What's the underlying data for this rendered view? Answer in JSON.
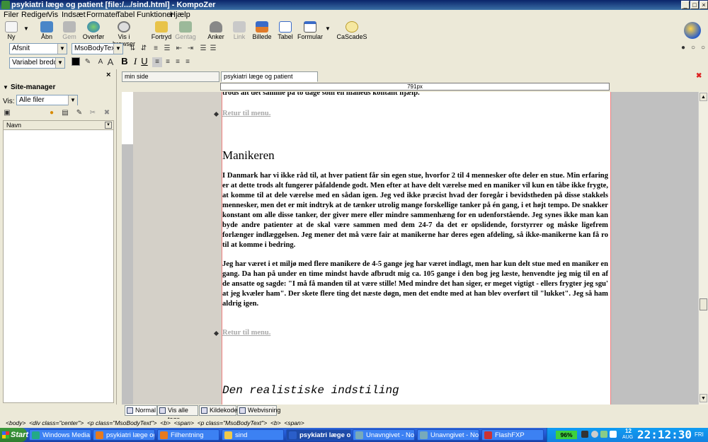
{
  "window": {
    "title": "psykiatri læge og patient [file:/.../sind.html] - KompoZer"
  },
  "menu": [
    "Filer",
    "Rediger",
    "Vis",
    "Indsæt",
    "Formater",
    "Tabel",
    "Funktioner",
    "Hjælp"
  ],
  "toolbar": {
    "buttons": [
      {
        "label": "Ny",
        "icon": "new-doc-icon"
      },
      {
        "label": "Åbn",
        "icon": "open-folder-icon"
      },
      {
        "label": "Gem",
        "icon": "save-disk-icon"
      },
      {
        "label": "Overfør",
        "icon": "publish-globe-icon"
      },
      {
        "label": "Vis i browser",
        "icon": "browser-preview-icon"
      },
      {
        "label": "Fortryd",
        "icon": "undo-arrow-icon"
      },
      {
        "label": "Gentag",
        "icon": "redo-arrow-icon"
      },
      {
        "label": "Anker",
        "icon": "anchor-icon"
      },
      {
        "label": "Link",
        "icon": "link-chain-icon"
      },
      {
        "label": "Billede",
        "icon": "image-icon"
      },
      {
        "label": "Tabel",
        "icon": "table-icon"
      },
      {
        "label": "Formular",
        "icon": "form-icon"
      },
      {
        "label": "CaScadeS",
        "icon": "css-editor-icon"
      }
    ]
  },
  "format1": {
    "paragraph_style": "Afsnit",
    "class_style": "MsoBodyText"
  },
  "format2": {
    "font": "Variabel bredde",
    "bold": "B",
    "italic": "I",
    "underline": "U"
  },
  "sidebar": {
    "title": "Site-manager",
    "view_label": "Vis:",
    "view_value": "Alle filer",
    "column_name": "Navn"
  },
  "tabs": [
    "min side",
    "psykiatri læge og patient"
  ],
  "ruler": "791px",
  "doc": {
    "top_text": "trods alt det samme på to dage som en måneds kontant hjælp.",
    "link1": "Retur til menu.",
    "heading": "Manikeren",
    "para1": " I Danmark har vi ikke råd til, at hver patient får sin egen stue, hvorfor 2 til 4 mennesker ofte deler en stue. Min erfaring er at dette trods alt fungerer påfaldende godt. Men efter at have delt værelse med en maniker vil kun en tåbe ikke frygte, at komme til at dele værelse med en sådan igen. Jeg ved ikke præcist hvad der foregår i bevidstheden på disse stakkels mennesker, men det er mit indtryk at de tænker utrolig mange forskellige tanker på én gang, i et højt tempo. De snakker konstant om alle disse tanker, der giver mere eller mindre sammenhæng for en udenforstående. Jeg synes ikke man kan byde andre patienter at de skal være sammen med dem 24-7 da det er opslidende, forstyrrer og måske ligefrem forlænger indlæggelsen. Jeg mener det må være fair at manikerne har deres egen afdeling, så ikke-manikerne kan få ro til at komme i bedring.",
    "para2": " Jeg har været i et miljø med flere manikere de 4-5 gange jeg har været indlagt, men har kun delt stue med en maniker en gang. Da han på under en time mindst havde afbrudt mig ca. 105 gange i den bog jeg læste, henvendte jeg mig til en af de ansatte og sagde: \"I må få manden til at være stille! Med mindre det han siger, er meget vigtigt - ellers frygter jeg sgu' at jeg kvæler ham\". Der skete flere ting det næste døgn, men det endte med at han blev overført til \"lukket\". Jeg så ham aldrig igen.",
    "link2": "Retur til menu.",
    "heading2": "Den realistiske indstiling"
  },
  "bottom_tabs": [
    "Normal",
    "Vis alle tags",
    "Kildekode",
    "Webvisning"
  ],
  "status_path": "<body>  <div class=\"center\">  <p class=\"MsoBodyText\">  <b>  <span>  <p class=\"MsoBodyText\">  <b>  <span>",
  "taskbar": {
    "start": "Start",
    "items": [
      "Windows Media Pl...",
      "psykiatri læge og ...",
      "Filhentning",
      "sind",
      "psykiatri læge o...",
      "Unavngivet - Note...",
      "Unavngivet - Note...",
      "FlashFXP"
    ],
    "battery": "96%",
    "clock": "22:12:30",
    "date_day": "12",
    "date_month": "AUG",
    "weekday": "FRI"
  },
  "colors": {
    "title_bar": "#0a246a",
    "taskbar": "#245edb",
    "link": "#aaaaaa"
  }
}
